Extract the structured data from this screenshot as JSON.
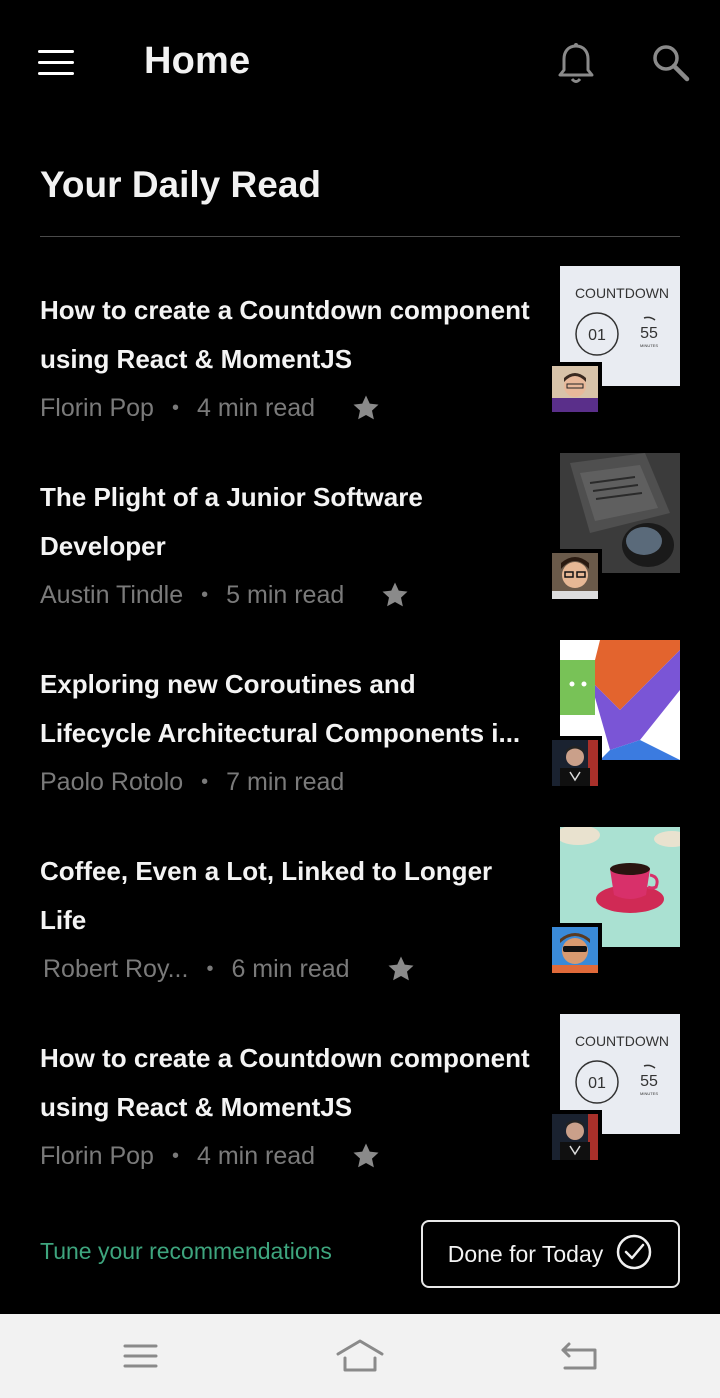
{
  "app": {
    "title": "Home"
  },
  "section": {
    "title": "Your Daily Read"
  },
  "articles": [
    {
      "title": "How to create a Countdown component using React & MomentJS",
      "author": "Florin Pop",
      "dot": "•",
      "read_time": "4 min read",
      "thumb": "countdown",
      "thumb_text": "COUNTDOWN",
      "thumb_num1": "01",
      "thumb_num2": "55",
      "thumb_small": "MINUTES"
    },
    {
      "title": "The Plight of a Junior Software Developer",
      "author": "Austin Tindle",
      "dot": "•",
      "read_time": "5 min read",
      "thumb": "desk"
    },
    {
      "title": "Exploring new Coroutines and Lifecycle Architectural Components i...",
      "author": "Paolo Rotolo",
      "dot": "•",
      "read_time": "7 min read",
      "thumb": "kotlin"
    },
    {
      "title": "Coffee, Even a Lot, Linked to Longer Life",
      "author": "Robert Roy...",
      "dot": "•",
      "read_time": "6 min read",
      "thumb": "coffee"
    },
    {
      "title": "How to create a Countdown component using React & MomentJS",
      "author": "Florin Pop",
      "dot": "•",
      "read_time": "4 min read",
      "thumb": "countdown",
      "thumb_text": "COUNTDOWN",
      "thumb_num1": "01",
      "thumb_num2": "55",
      "thumb_small": "MINUTES"
    }
  ],
  "footer": {
    "tune_link": "Tune your recommendations",
    "done_label": "Done for Today"
  },
  "icons": {
    "menu": "menu-icon",
    "bell": "bell-icon",
    "search": "search-icon",
    "star": "star-icon",
    "check": "check-circle-icon"
  },
  "colors": {
    "background": "#000000",
    "accent": "#3ea57e",
    "meta_text": "#7a7a7a",
    "navbar": "#f2f2f2"
  }
}
